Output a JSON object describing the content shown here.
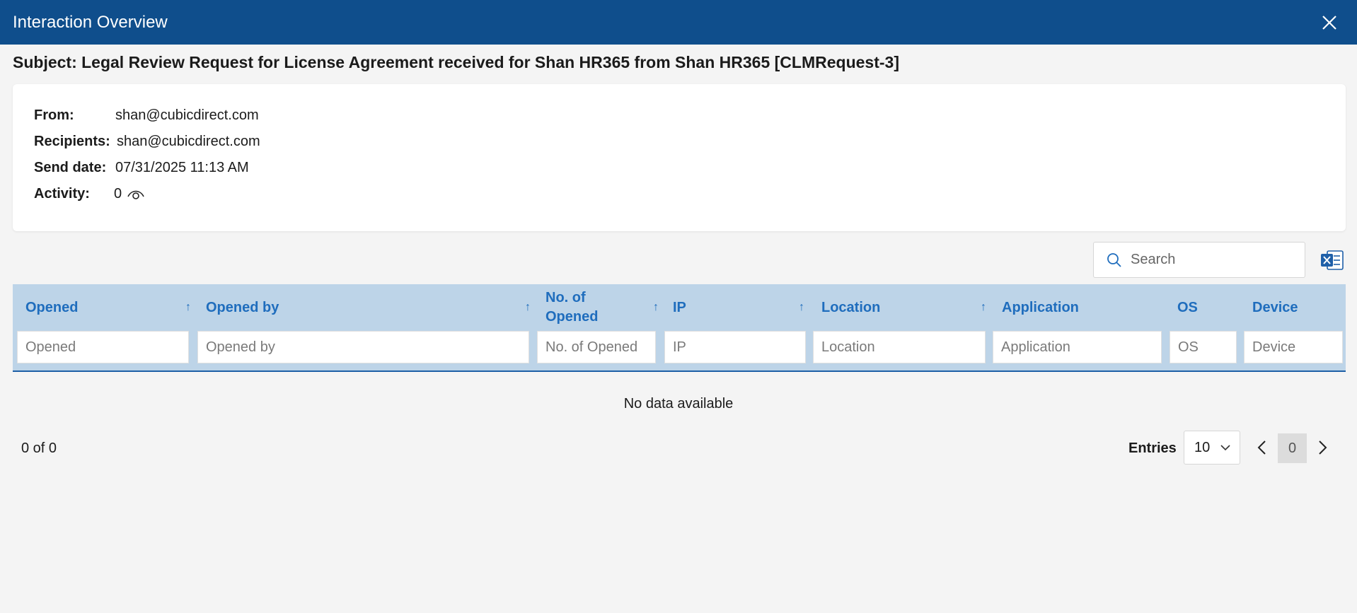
{
  "window": {
    "title": "Interaction Overview"
  },
  "subject": "Subject: Legal Review Request for License Agreement received for Shan HR365 from Shan HR365 [CLMRequest-3]",
  "details": {
    "from_label": "From:",
    "from_value": "shan@cubicdirect.com",
    "recipients_label": "Recipients:",
    "recipients_value": "shan@cubicdirect.com",
    "send_date_label": "Send date:",
    "send_date_value": "07/31/2025 11:13 AM",
    "activity_label": "Activity:",
    "activity_value": "0",
    "activity_icon": "eye-icon"
  },
  "toolbar": {
    "search_placeholder": "Search",
    "export_icon": "excel-export-icon"
  },
  "grid": {
    "columns": [
      {
        "label": "Opened",
        "filter_placeholder": "Opened",
        "sortable": true
      },
      {
        "label": "Opened by",
        "filter_placeholder": "Opened by",
        "sortable": true
      },
      {
        "label": "No. of Opened",
        "filter_placeholder": "No. of Opened",
        "sortable": true
      },
      {
        "label": "IP",
        "filter_placeholder": "IP",
        "sortable": true
      },
      {
        "label": "Location",
        "filter_placeholder": "Location",
        "sortable": true
      },
      {
        "label": "Application",
        "filter_placeholder": "Application",
        "sortable": false
      },
      {
        "label": "OS",
        "filter_placeholder": "OS",
        "sortable": false
      },
      {
        "label": "Device",
        "filter_placeholder": "Device",
        "sortable": false
      }
    ],
    "empty_text": "No data available"
  },
  "pagination": {
    "count_text": "0 of 0",
    "entries_label": "Entries",
    "entries_value": "10",
    "current_page": "0"
  },
  "colors": {
    "header_bar": "#0f4e8c",
    "grid_header": "#bdd4e8",
    "accent_text": "#1f6dbd"
  }
}
